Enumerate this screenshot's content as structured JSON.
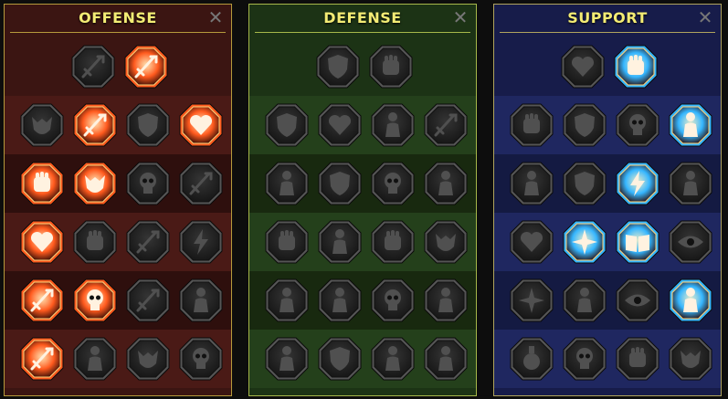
{
  "panels": [
    {
      "key": "offense",
      "title": "OFFENSE",
      "close": "✕",
      "theme": {
        "bg": "#3b1512",
        "row_light": "#4a1a16",
        "row_dark": "#2e0f0d",
        "accent": "#ff5a1e"
      },
      "rows": [
        [
          {
            "icon": "crossed-swords-icon",
            "active": false
          },
          {
            "icon": "sword-slash-icon",
            "active": true
          }
        ],
        [
          {
            "icon": "horned-demon-icon",
            "active": false
          },
          {
            "icon": "raining-blades-icon",
            "active": true
          },
          {
            "icon": "shield-break-icon",
            "active": false
          },
          {
            "icon": "bleeding-heart-icon",
            "active": true
          }
        ],
        [
          {
            "icon": "punch-impact-icon",
            "active": true
          },
          {
            "icon": "fanged-maw-icon",
            "active": true
          },
          {
            "icon": "smoking-skull-icon",
            "active": false
          },
          {
            "icon": "scythe-icon",
            "active": false
          }
        ],
        [
          {
            "icon": "pierced-heart-icon",
            "active": true
          },
          {
            "icon": "gauntlet-icon",
            "active": false
          },
          {
            "icon": "axe-icon",
            "active": false
          },
          {
            "icon": "lightning-chain-icon",
            "active": false
          }
        ],
        [
          {
            "icon": "sword-burst-icon",
            "active": true
          },
          {
            "icon": "twin-skulls-icon",
            "active": true
          },
          {
            "icon": "spear-icon",
            "active": false
          },
          {
            "icon": "warrior-icon",
            "active": false
          }
        ],
        [
          {
            "icon": "sparkling-sword-icon",
            "active": true
          },
          {
            "icon": "knight-helm-icon",
            "active": false
          },
          {
            "icon": "spider-icon",
            "active": false
          },
          {
            "icon": "skull-chest-icon",
            "active": false
          }
        ]
      ]
    },
    {
      "key": "defense",
      "title": "DEFENSE",
      "close": "✕",
      "theme": {
        "bg": "#1c3315",
        "row_light": "#24401b",
        "row_dark": "#18290f",
        "accent": "#8fbf4a"
      },
      "rows": [
        [
          {
            "icon": "brick-wall-icon",
            "active": false
          },
          {
            "icon": "raised-fist-icon",
            "active": false
          }
        ],
        [
          {
            "icon": "chevron-armor-icon",
            "active": false
          },
          {
            "icon": "heart-shield-icon",
            "active": false
          },
          {
            "icon": "muscle-man-icon",
            "active": false
          },
          {
            "icon": "blade-drop-icon",
            "active": false
          }
        ],
        [
          {
            "icon": "rogue-icon",
            "active": false
          },
          {
            "icon": "knight-shield-icon",
            "active": false
          },
          {
            "icon": "skull-heart-icon",
            "active": false
          },
          {
            "icon": "halo-face-icon",
            "active": false
          }
        ],
        [
          {
            "icon": "reaching-hands-icon",
            "active": false
          },
          {
            "icon": "hourglass-sun-icon",
            "active": false
          },
          {
            "icon": "open-palm-icon",
            "active": false
          },
          {
            "icon": "bull-head-icon",
            "active": false
          }
        ],
        [
          {
            "icon": "running-man-icon",
            "active": false
          },
          {
            "icon": "claw-marks-icon",
            "active": false
          },
          {
            "icon": "skull-crown-icon",
            "active": false
          },
          {
            "icon": "deflect-icon",
            "active": false
          }
        ],
        [
          {
            "icon": "rising-hero-icon",
            "active": false
          },
          {
            "icon": "wing-shield-icon",
            "active": false
          },
          {
            "icon": "brute-icon",
            "active": false
          },
          {
            "icon": "flexing-figure-icon",
            "active": false
          }
        ]
      ]
    },
    {
      "key": "support",
      "title": "SUPPORT",
      "close": "✕",
      "theme": {
        "bg": "#171c4a",
        "row_light": "#1f2760",
        "row_dark": "#141a42",
        "accent": "#35b6ff"
      },
      "rows": [
        [
          {
            "icon": "heart-sparkle-icon",
            "active": false
          },
          {
            "icon": "spiral-hand-icon",
            "active": true
          }
        ],
        [
          {
            "icon": "praying-hands-icon",
            "active": false
          },
          {
            "icon": "ripple-shield-icon",
            "active": false
          },
          {
            "icon": "flaming-skull-icon",
            "active": false
          },
          {
            "icon": "speed-arrows-icon",
            "active": true
          }
        ],
        [
          {
            "icon": "mage-glow-icon",
            "active": false
          },
          {
            "icon": "lightning-shield-icon",
            "active": false
          },
          {
            "icon": "shattered-bolt-icon",
            "active": true
          },
          {
            "icon": "twin-figures-icon",
            "active": false
          }
        ],
        [
          {
            "icon": "chained-heart-icon",
            "active": false
          },
          {
            "icon": "comet-icon",
            "active": true
          },
          {
            "icon": "open-book-icon",
            "active": true
          },
          {
            "icon": "glaring-eyes-icon",
            "active": false
          }
        ],
        [
          {
            "icon": "compass-star-icon",
            "active": false
          },
          {
            "icon": "winged-boot-icon",
            "active": false
          },
          {
            "icon": "eye-icon",
            "active": false
          },
          {
            "icon": "leaping-figure-icon",
            "active": true
          }
        ],
        [
          {
            "icon": "potion-icon",
            "active": false
          },
          {
            "icon": "skull-icon",
            "active": false
          },
          {
            "icon": "grasping-hand-icon",
            "active": false
          },
          {
            "icon": "eagle-icon",
            "active": false
          }
        ]
      ]
    }
  ]
}
